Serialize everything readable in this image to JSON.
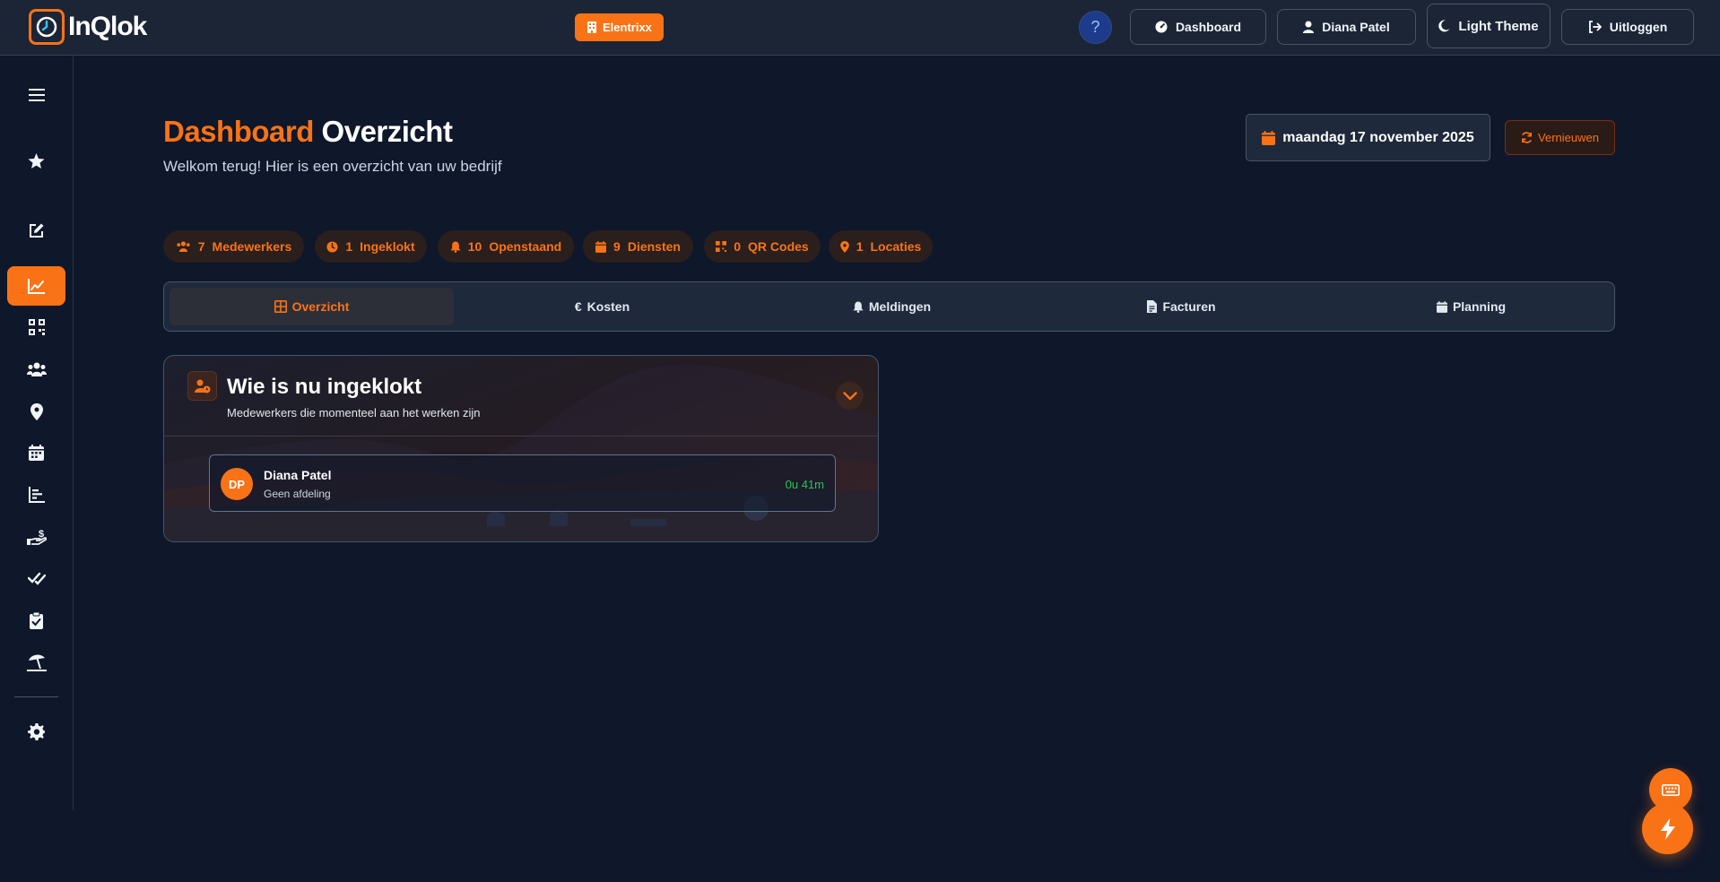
{
  "app": {
    "logo_text": "InQlok",
    "company": "Elentrixx"
  },
  "topnav": {
    "help": "?",
    "dashboard": "Dashboard",
    "user": "Diana Patel",
    "theme": "Light Theme",
    "logout": "Uitloggen"
  },
  "header": {
    "title_accent": "Dashboard",
    "title_main": "Overzicht",
    "subtitle": "Welkom terug! Hier is een overzicht van uw bedrijf",
    "date": "maandag 17 november 2025",
    "refresh": "Vernieuwen"
  },
  "stats": [
    {
      "value": "7",
      "label": "Medewerkers",
      "icon": "users-icon"
    },
    {
      "value": "1",
      "label": "Ingeklokt",
      "icon": "clock-icon"
    },
    {
      "value": "10",
      "label": "Openstaand",
      "icon": "bell-icon"
    },
    {
      "value": "9",
      "label": "Diensten",
      "icon": "calendar-icon"
    },
    {
      "value": "0",
      "label": "QR Codes",
      "icon": "qrcode-icon"
    },
    {
      "value": "1",
      "label": "Locaties",
      "icon": "location-pin-icon"
    }
  ],
  "tabs": [
    {
      "label": "Overzicht",
      "icon": "grid-icon",
      "active": true
    },
    {
      "label": "Kosten",
      "icon": "euro-icon"
    },
    {
      "label": "Meldingen",
      "icon": "bell-icon"
    },
    {
      "label": "Facturen",
      "icon": "document-icon"
    },
    {
      "label": "Planning",
      "icon": "calendar-icon"
    }
  ],
  "clocked_in_card": {
    "title": "Wie is nu ingeklokt",
    "subtitle": "Medewerkers die momenteel aan het werken zijn",
    "employees": [
      {
        "initials": "DP",
        "name": "Diana Patel",
        "department": "Geen afdeling",
        "duration": "0u 41m"
      }
    ]
  },
  "sidebar": {
    "active": "chart-line-icon",
    "icons": [
      "menu-icon",
      "star-icon",
      "edit-icon",
      "chart-line-icon",
      "qrcode-icon",
      "users-icon",
      "location-pin-icon",
      "calendar-icon",
      "bar-chart-icon",
      "hand-coin-icon",
      "double-check-icon",
      "clipboard-check-icon",
      "beach-umbrella-icon",
      "gear-icon"
    ]
  },
  "colors": {
    "accent": "#f97316",
    "background": "#0f172a",
    "panel": "#1e293b",
    "success": "#22c55e"
  }
}
